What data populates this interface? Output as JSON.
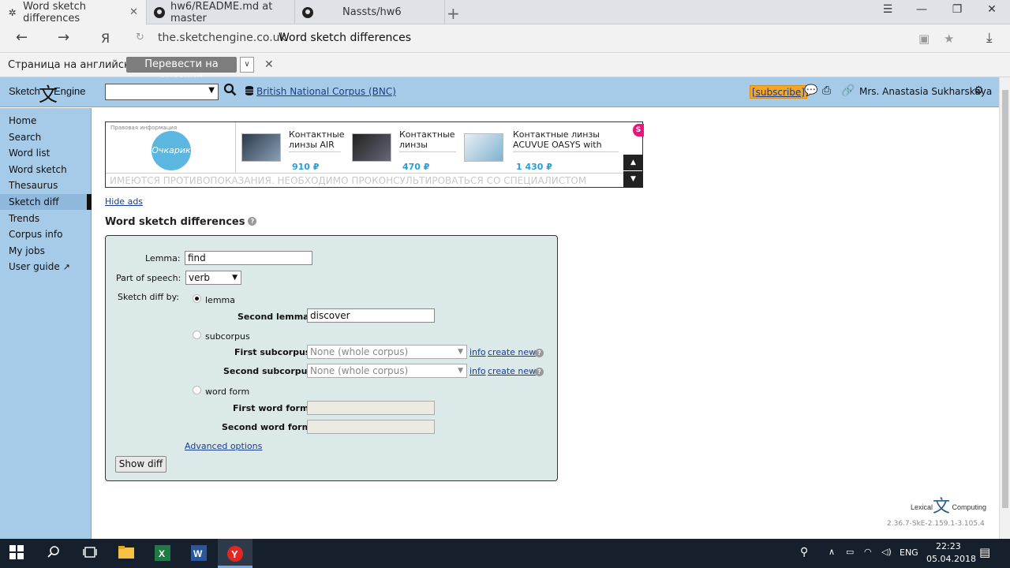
{
  "browser": {
    "tabs": [
      {
        "title": "Word sketch differences",
        "icon": "✲"
      },
      {
        "title": "hw6/README.md at master",
        "icon": "●"
      },
      {
        "title": "Nassts/hw6",
        "icon": "●"
      }
    ],
    "url_domain": "the.sketchengine.co.uk",
    "url_title": "Word sketch differences",
    "yandex_label": "Я"
  },
  "translate": {
    "text": "Страница на английском",
    "button": "Перевести на русский"
  },
  "header": {
    "logo_left": "Sketch",
    "logo_right": "Engine",
    "corpus": "British National Corpus (BNC)",
    "subscribe": "[subscribe]",
    "user": "Mrs. Anastasia Sukharskaya"
  },
  "sidebar": {
    "items": [
      {
        "label": "Home"
      },
      {
        "label": "Search"
      },
      {
        "label": "Word list"
      },
      {
        "label": "Word sketch"
      },
      {
        "label": "Thesaurus"
      },
      {
        "label": "Sketch diff"
      },
      {
        "label": "Trends"
      },
      {
        "label": "Corpus info"
      },
      {
        "label": "My jobs"
      },
      {
        "label": "User guide"
      }
    ],
    "active": "Sketch diff"
  },
  "ad": {
    "disclaimer_small": "Правовая информация",
    "logo_text": "Очкарик",
    "products": [
      {
        "name_line1": "Контактные",
        "name_line2": "линзы AIR",
        "price": "910 ₽"
      },
      {
        "name_line1": "Контактные",
        "name_line2": "линзы",
        "price": "470 ₽"
      },
      {
        "name_line1": "Контактные линзы",
        "name_line2": "ACUVUE OASYS with",
        "price": "1 430 ₽"
      }
    ],
    "warning": "ИМЕЮТСЯ ПРОТИВОПОКАЗАНИЯ. НЕОБХОДИМО ПРОКОНСУЛЬТИРОВАТЬСЯ СО СПЕЦИАЛИСТОМ",
    "badge": "S"
  },
  "hide_ads": "Hide ads",
  "page_title": "Word sketch differences",
  "form": {
    "lemma_label": "Lemma:",
    "lemma_value": "find",
    "pos_label": "Part of speech:",
    "pos_value": "verb",
    "diff_by_label": "Sketch diff by:",
    "opt_lemma": "lemma",
    "second_lemma_label": "Second lemma:",
    "second_lemma_value": "discover",
    "opt_subcorpus": "subcorpus",
    "first_subcorpus_label": "First subcorpus:",
    "second_subcorpus_label": "Second subcorpus:",
    "subcorpus_value": "None (whole corpus)",
    "info_link": "info",
    "create_new_link": "create new",
    "opt_wordform": "word form",
    "first_wordform_label": "First word form:",
    "second_wordform_label": "Second word form:",
    "advanced": "Advanced options",
    "submit": "Show diff"
  },
  "footer": {
    "lc_left": "Lexical",
    "lc_right": "Computing",
    "version": "2.36.7-SkE-2.159.1-3.105.4"
  },
  "taskbar": {
    "lang": "ENG",
    "time": "22:23",
    "date": "05.04.2018"
  }
}
